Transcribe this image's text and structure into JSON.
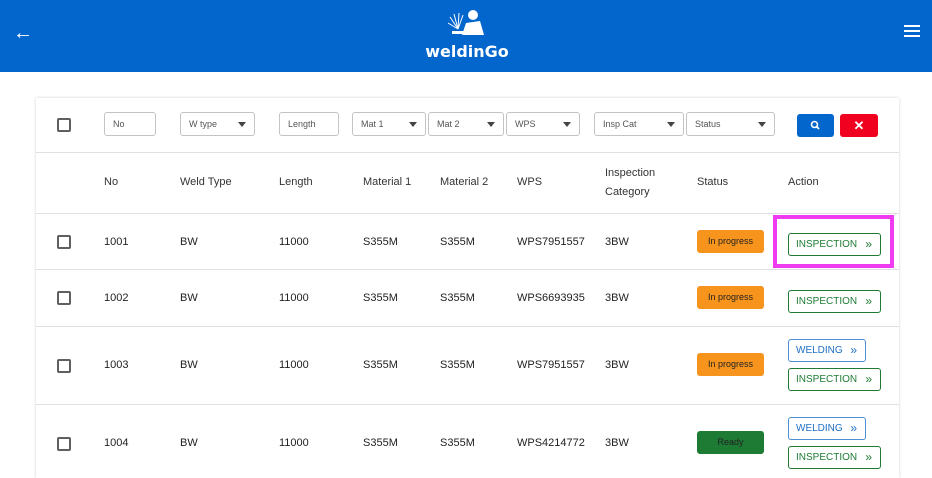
{
  "app": {
    "brand": "weldinGo",
    "back_icon": "arrow-left-icon",
    "menu_icon": "hamburger-menu-icon",
    "logo_icon": "welder-logo-icon",
    "header_color": "#0366cc"
  },
  "filters": {
    "no": "No",
    "weld_type": "W type",
    "length": "Length",
    "mat1": "Mat 1",
    "mat2": "Mat 2",
    "wps": "WPS",
    "insp_cat": "Insp Cat",
    "status": "Status",
    "search_icon": "search-icon",
    "clear_label": "✕",
    "search_color": "#0366cc",
    "clear_color": "#f0011f"
  },
  "columns": {
    "no": "No",
    "weld_type": "Weld Type",
    "length": "Length",
    "material1": "Material 1",
    "material2": "Material 2",
    "wps": "WPS",
    "inspection_category_1": "Inspection",
    "inspection_category_2": "Category",
    "status": "Status",
    "action": "Action"
  },
  "rows": [
    {
      "no": "1001",
      "weld_type": "BW",
      "length": "11000",
      "material1": "S355M",
      "material2": "S355M",
      "wps": "WPS7951557",
      "insp_cat": "3BW",
      "status": "In progress",
      "actions": [
        "INSPECTION"
      ]
    },
    {
      "no": "1002",
      "weld_type": "BW",
      "length": "11000",
      "material1": "S355M",
      "material2": "S355M",
      "wps": "WPS6693935",
      "insp_cat": "3BW",
      "status": "In progress",
      "actions": [
        "INSPECTION"
      ]
    },
    {
      "no": "1003",
      "weld_type": "BW",
      "length": "11000",
      "material1": "S355M",
      "material2": "S355M",
      "wps": "WPS7951557",
      "insp_cat": "3BW",
      "status": "In progress",
      "actions": [
        "WELDING",
        "INSPECTION"
      ]
    },
    {
      "no": "1004",
      "weld_type": "BW",
      "length": "11000",
      "material1": "S355M",
      "material2": "S355M",
      "wps": "WPS4214772",
      "insp_cat": "3BW",
      "status": "Ready",
      "actions": [
        "WELDING",
        "INSPECTION"
      ]
    }
  ],
  "status_colors": {
    "in_progress": "#f7941d",
    "ready": "#1e7b34"
  },
  "action_icon": "double-chevron-right-icon",
  "highlight_color": "#f03cf0"
}
